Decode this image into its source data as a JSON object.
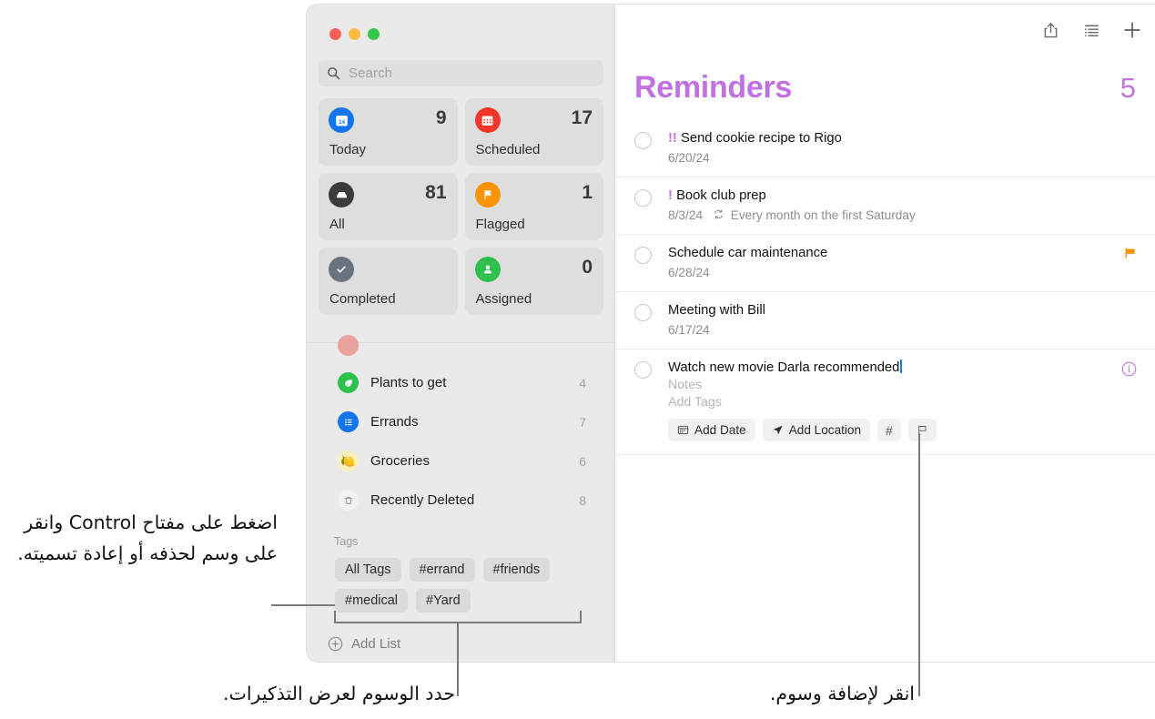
{
  "window": {
    "traffic_lights": [
      "close",
      "minimize",
      "zoom"
    ],
    "colors": {
      "red": "#fc6058",
      "yellow": "#fdbc40",
      "green": "#34c749",
      "accent_purple": "#c272e0",
      "flag_orange": "#f89406"
    }
  },
  "sidebar": {
    "search": {
      "placeholder": "Search",
      "icon": "search-icon"
    },
    "smart_lists": [
      {
        "label": "Today",
        "count": "9",
        "icon": "calendar-today-icon",
        "color": "#1275f0"
      },
      {
        "label": "Scheduled",
        "count": "17",
        "icon": "calendar-scheduled-icon",
        "color": "#f5342a"
      },
      {
        "label": "All",
        "count": "81",
        "icon": "inbox-tray-icon",
        "color": "#3b3b3b"
      },
      {
        "label": "Flagged",
        "count": "1",
        "icon": "flag-icon",
        "color": "#f89406"
      },
      {
        "label": "Completed",
        "count": "",
        "icon": "checkmark-icon",
        "color": "#6a7481"
      },
      {
        "label": "Assigned",
        "count": "0",
        "icon": "person-icon",
        "color": "#2ec14e"
      }
    ],
    "lists": [
      {
        "label": "Plants to get",
        "count": "4",
        "icon": "leaf-icon",
        "color": "#2ec14e"
      },
      {
        "label": "Errands",
        "count": "7",
        "icon": "bulleted-list-icon",
        "color": "#1275f0"
      },
      {
        "label": "Groceries",
        "count": "6",
        "icon": "lemon-icon",
        "color": "#fdf0b8"
      },
      {
        "label": "Recently Deleted",
        "count": "8",
        "icon": "trash-icon",
        "color": "#f2f2f2"
      }
    ],
    "tags_header": "Tags",
    "tags": [
      "All Tags",
      "#errand",
      "#friends",
      "#medical",
      "#Yard"
    ],
    "add_list": {
      "label": "Add List",
      "icon": "plus-circle-icon"
    }
  },
  "content": {
    "toolbar": [
      {
        "name": "share-icon",
        "label": "Share"
      },
      {
        "name": "sort-list-icon",
        "label": "View options"
      },
      {
        "name": "plus-icon",
        "label": "New reminder"
      }
    ],
    "title": "Reminders",
    "count": "5",
    "reminders": [
      {
        "priority": "!!",
        "title": "Send cookie recipe to Rigo",
        "date": "6/20/24",
        "repeat": "",
        "flagged": false,
        "editing": false
      },
      {
        "priority": "!",
        "title": "Book club prep",
        "date": "8/3/24",
        "repeat": "Every month on the first Saturday",
        "flagged": false,
        "editing": false
      },
      {
        "priority": "",
        "title": "Schedule car maintenance",
        "date": "6/28/24",
        "repeat": "",
        "flagged": true,
        "editing": false
      },
      {
        "priority": "",
        "title": "Meeting with Bill",
        "date": "6/17/24",
        "repeat": "",
        "flagged": false,
        "editing": false
      },
      {
        "priority": "",
        "title": "Watch new movie Darla recommended",
        "date": "",
        "repeat": "",
        "flagged": false,
        "editing": true,
        "notes_placeholder": "Notes",
        "tags_placeholder": "Add Tags",
        "buttons": [
          {
            "name": "add-date-button",
            "label": "Add Date",
            "icon": "calendar-icon"
          },
          {
            "name": "add-location-button",
            "label": "Add Location",
            "icon": "location-arrow-icon"
          },
          {
            "name": "add-tag-button",
            "label": "#",
            "icon": "hash-icon"
          },
          {
            "name": "flag-button",
            "label": "",
            "icon": "flag-outline-icon"
          }
        ],
        "info_icon": "info-circle-icon"
      }
    ]
  },
  "callouts": {
    "tags_control_click": "اضغط على مفتاح Control وانقر على وسم لحذفه أو إعادة تسميته.",
    "select_tags": "حدد الوسوم لعرض التذكيرات.",
    "click_add_tags": "انقر لإضافة وسوم."
  }
}
